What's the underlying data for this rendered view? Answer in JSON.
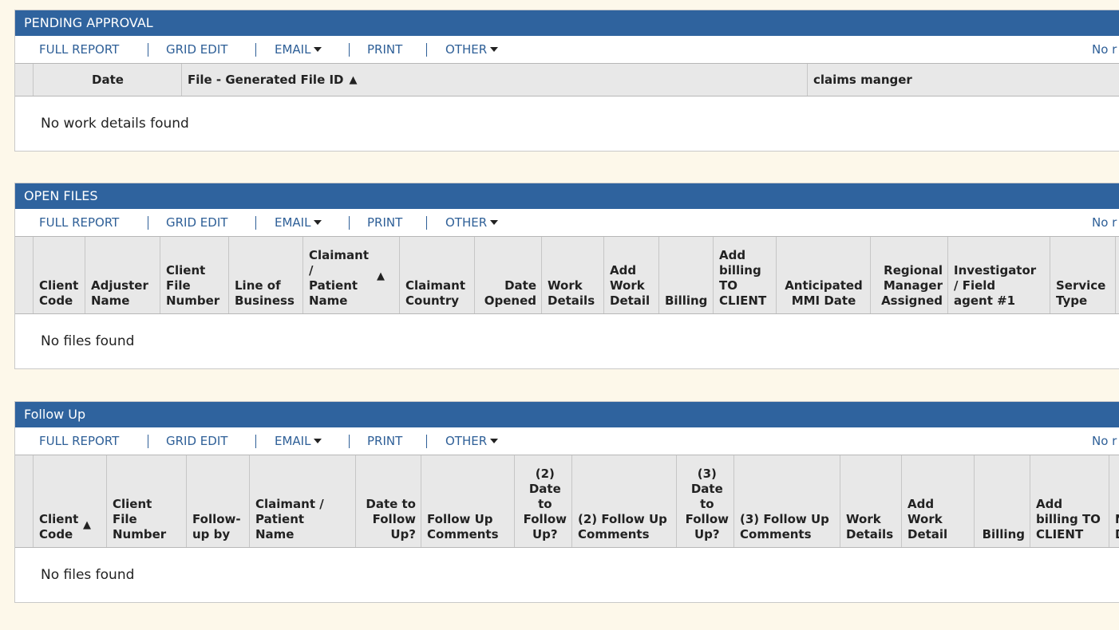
{
  "toolbar": {
    "full_report": "FULL REPORT",
    "grid_edit": "GRID EDIT",
    "email": "EMAIL",
    "print": "PRINT",
    "other": "OTHER",
    "right_clip": "No r"
  },
  "pending": {
    "title": "PENDING APPROVAL",
    "columns": [
      "Date",
      "File - Generated File ID",
      "claims manger"
    ],
    "empty": "No work details found"
  },
  "open_files": {
    "title": "OPEN FILES",
    "columns": [
      "Client\nCode",
      "Adjuster\nName",
      "Client\nFile\nNumber",
      "Line of\nBusiness",
      "Claimant\n/\nPatient\nName",
      "Claimant\nCountry",
      "Date\nOpened",
      "Work\nDetails",
      "Add\nWork\nDetail",
      "Billing",
      "Add\nbilling\nTO\nCLIENT",
      "Anticipated\nMMI Date",
      "Regional\nManager\nAssigned",
      "Investigator\n/ Field\nagent #1",
      "Service\nType"
    ],
    "empty": "No files found"
  },
  "follow_up": {
    "title": "Follow Up",
    "columns": [
      "Client\nCode",
      "Client\nFile\nNumber",
      "Follow-\nup by",
      "Claimant /\nPatient\nName",
      "Date to\nFollow\nUp?",
      "Follow Up\nComments",
      "(2)\nDate\nto\nFollow\nUp?",
      "(2) Follow Up\nComments",
      "(3)\nDate\nto\nFollow\nUp?",
      "(3) Follow Up\nComments",
      "Work\nDetails",
      "Add\nWork\nDetail",
      "Billing",
      "Add\nbilling TO\nCLIENT",
      "N\nD"
    ],
    "empty": "No files found"
  }
}
